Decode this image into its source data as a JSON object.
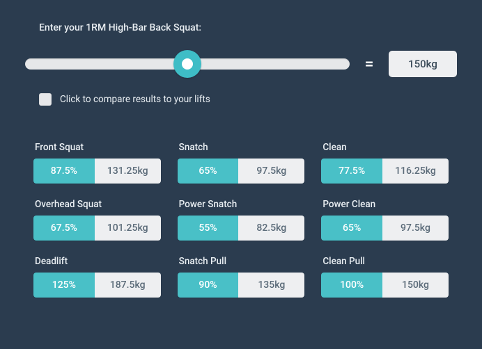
{
  "prompt": "Enter your 1RM High-Bar Back Squat:",
  "equals": "=",
  "oneRM": "150kg",
  "compare": {
    "label": "Click to compare results to your lifts"
  },
  "lifts": [
    {
      "name": "Front Squat",
      "pct": "87.5%",
      "wt": "131.25kg"
    },
    {
      "name": "Snatch",
      "pct": "65%",
      "wt": "97.5kg"
    },
    {
      "name": "Clean",
      "pct": "77.5%",
      "wt": "116.25kg"
    },
    {
      "name": "Overhead Squat",
      "pct": "67.5%",
      "wt": "101.25kg"
    },
    {
      "name": "Power Snatch",
      "pct": "55%",
      "wt": "82.5kg"
    },
    {
      "name": "Power Clean",
      "pct": "65%",
      "wt": "97.5kg"
    },
    {
      "name": "Deadlift",
      "pct": "125%",
      "wt": "187.5kg"
    },
    {
      "name": "Snatch Pull",
      "pct": "90%",
      "wt": "135kg"
    },
    {
      "name": "Clean Pull",
      "pct": "100%",
      "wt": "150kg"
    }
  ]
}
